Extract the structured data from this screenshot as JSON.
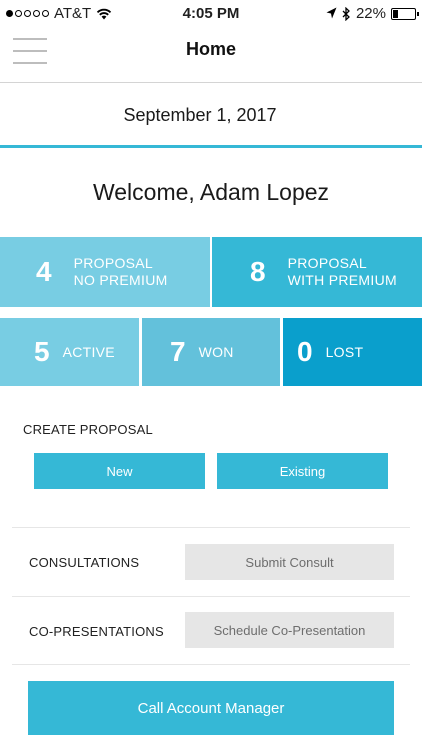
{
  "status_bar": {
    "carrier": "AT&T",
    "time": "4:05 PM",
    "battery": "22%",
    "icons": [
      "signal-dots-icon",
      "wifi-icon",
      "location-arrow-icon",
      "bluetooth-icon",
      "battery-icon"
    ],
    "battery_level": 0.22
  },
  "nav": {
    "title": "Home",
    "menu_icon": "hamburger-menu-icon"
  },
  "date": "September 1, 2017",
  "welcome": "Welcome, Adam Lopez",
  "stats": {
    "proposal_no_premium": {
      "count": "4",
      "label_line1": "PROPOSAL",
      "label_line2": "NO PREMIUM"
    },
    "proposal_with_premium": {
      "count": "8",
      "label_line1": "PROPOSAL",
      "label_line2": "WITH PREMIUM"
    },
    "active": {
      "count": "5",
      "label": "ACTIVE"
    },
    "won": {
      "count": "7",
      "label": "WON"
    },
    "lost": {
      "count": "0",
      "label": "LOST"
    }
  },
  "create_proposal": {
    "label": "CREATE PROPOSAL",
    "new_label": "New",
    "existing_label": "Existing"
  },
  "consultations": {
    "label": "CONSULTATIONS",
    "button_label": "Submit Consult"
  },
  "co_presentations": {
    "label": "CO-PRESENTATIONS",
    "button_label": "Schedule Co-Presentation"
  },
  "call_button_label": "Call Account Manager",
  "colors": {
    "accent": "#35b8d6",
    "tile_light": "#78cde3",
    "tile_mid": "#63c1db",
    "tile_dark": "#0a9fcc",
    "button_gray": "#e6e6e6"
  }
}
